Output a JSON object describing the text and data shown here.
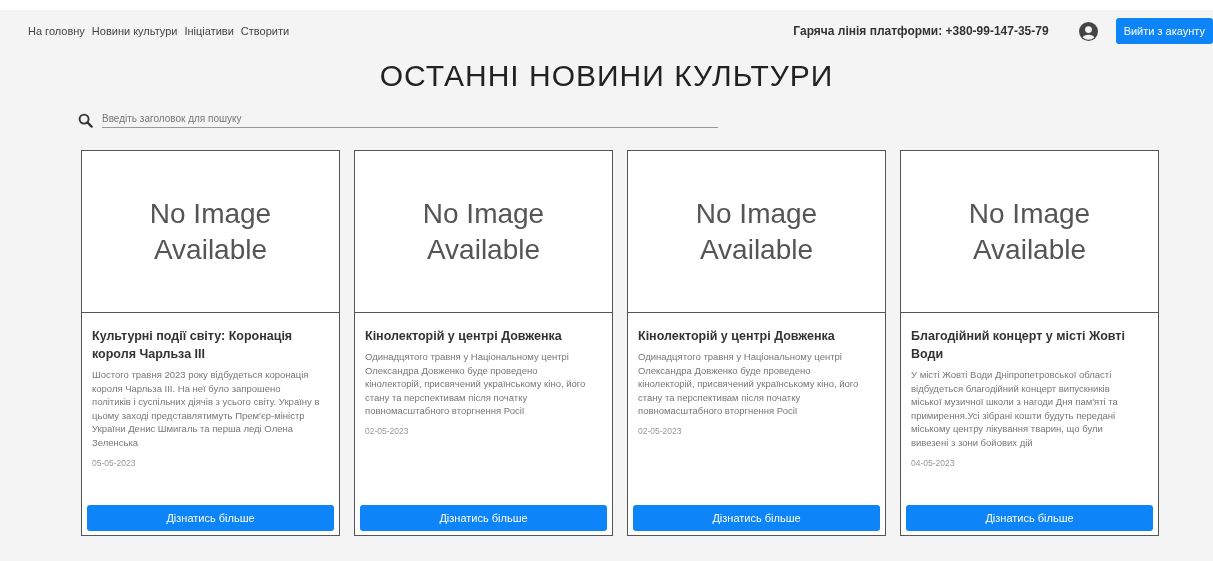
{
  "nav": {
    "links": [
      "На головну",
      "Новини культури",
      "Ініціативи",
      "Створити"
    ],
    "hotline": "Гаряча лінія платформи: +380-99-147-35-79",
    "logout_button": "Вийти з акаунту"
  },
  "heading": "ОСТАННІ НОВИНИ КУЛЬТУРИ",
  "search": {
    "placeholder": "Введіть заголовок для пошуку"
  },
  "cards": [
    {
      "image_text": "No Image Available",
      "title": "Культурні події світу: Коронація короля Чарльза III",
      "text": "Шостого травня 2023 року відбудеться коронація короля Чарльза III. На неї було запрошено політиків і суспільних діячів з усього світу. Україну в цьому заході представлятимуть Прем'єр-міністр України Денис Шмигаль та перша леді Олена Зеленська",
      "date": "05-05-2023",
      "button": "Дізнатись більше"
    },
    {
      "image_text": "No Image Available",
      "title": "Кінолекторій у центрі Довженка",
      "text": "Одинадцятого травня у Національному центрі Олександра Довженко буде проведено кінолекторій, присвячений українському кіно, його стану та перспективам після початку повномасштабного вторгнення Росії",
      "date": "02-05-2023",
      "button": "Дізнатись більше"
    },
    {
      "image_text": "No Image Available",
      "title": "Кінолекторій у центрі Довженка",
      "text": "Одинадцятого травня у Національному центрі Олександра Довженко буде проведено кінолекторій, присвячений українському кіно, його стану та перспективам після початку повномасштабного вторгнення Росії",
      "date": "02-05-2023",
      "button": "Дізнатись більше"
    },
    {
      "image_text": "No Image Available",
      "title": "Благодійний концерт у місті Жовті Води",
      "text": "У місті Жовті Води Дніпропетровської області відбудеться благодійний концерт випускників міської музичної школи з нагоди Дня пам'яті та примирення.Усі зібрані кошти будуть передані міському центру лікування тварин, що були вивезені з зони бойових дій",
      "date": "04-05-2023",
      "button": "Дізнатись більше"
    }
  ]
}
